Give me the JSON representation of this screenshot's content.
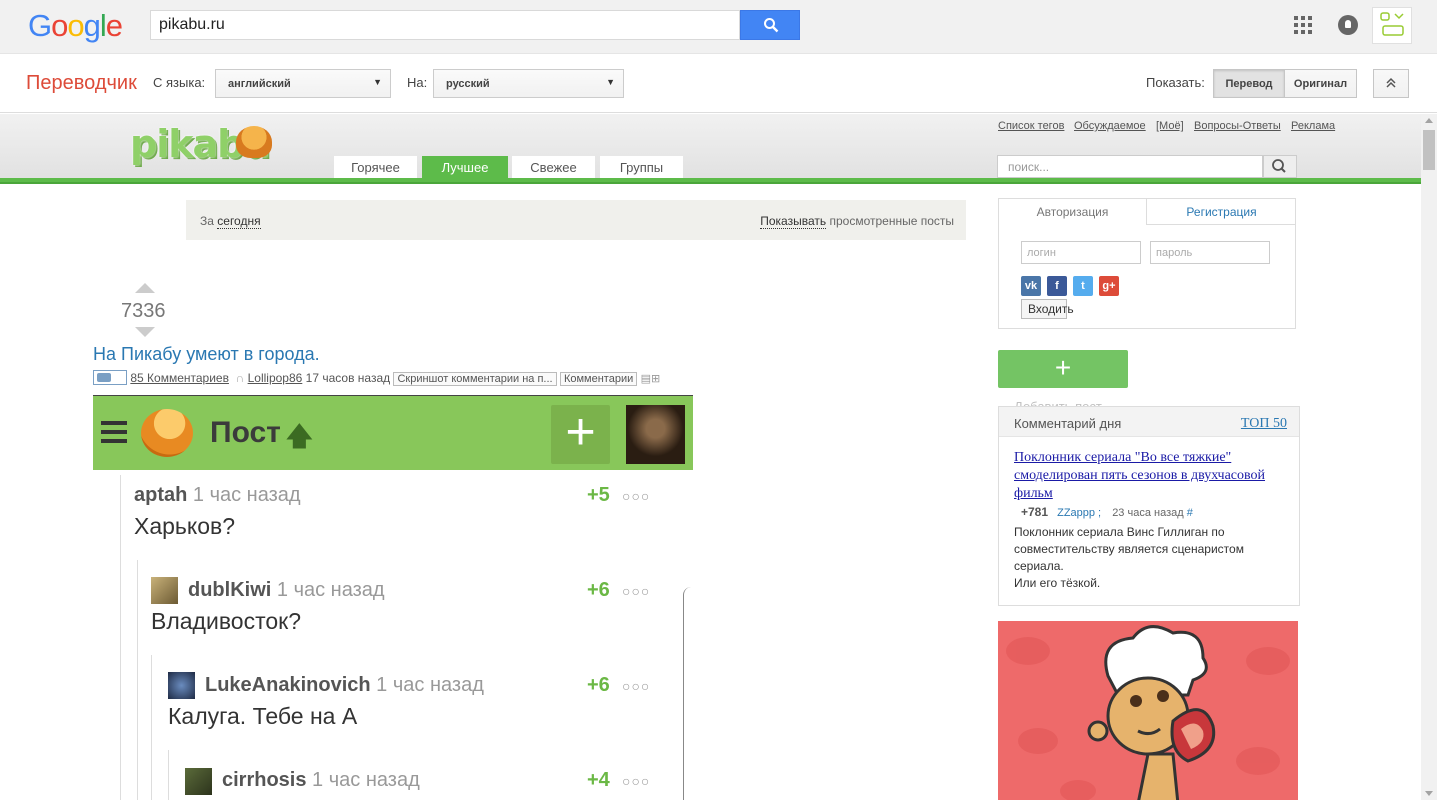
{
  "google": {
    "logo": [
      "G",
      "o",
      "o",
      "g",
      "l",
      "e"
    ],
    "logo_colors": [
      "#4285f4",
      "#ea4335",
      "#fbbc05",
      "#4285f4",
      "#34a853",
      "#ea4335"
    ],
    "search_value": "pikabu.ru"
  },
  "translate": {
    "title": "Переводчик",
    "from_label": "С языка:",
    "from_value": "английский",
    "to_label": "На:",
    "to_value": "русский",
    "show_label": "Показать:",
    "btn_translation": "Перевод",
    "btn_original": "Оригинал"
  },
  "pikabu": {
    "logo": "pikabu",
    "top_menu": [
      "Список тегов",
      "Обсуждаемое",
      "[Моё]",
      "Вопросы-Ответы",
      "Реклама"
    ],
    "tabs": [
      "Горячее",
      "Лучшее",
      "Свежее",
      "Группы"
    ],
    "active_tab": "Лучшее",
    "search_placeholder": "поиск...",
    "accent": "#5dbb4a"
  },
  "filter": {
    "prefix": "За",
    "period": "сегодня",
    "show": "Показывать",
    "show_rest": "просмотренные посты"
  },
  "post": {
    "rating": "7336",
    "title": "На Пикабу умеют в города.",
    "comments": "85 Комментариев",
    "author": "Lollipop86",
    "time": "17 часов назад",
    "tags": [
      "Скриншот комментарии на п...",
      "Комментарии"
    ]
  },
  "screenshot": {
    "header_title": "Пост",
    "comments": [
      {
        "author": "aptah",
        "time": "1 час назад",
        "score": "+5",
        "text": "Харьков?"
      },
      {
        "author": "dublKiwi",
        "time": "1 час назад",
        "score": "+6",
        "text": "Владивосток?"
      },
      {
        "author": "LukeAnakinovich",
        "time": "1 час назад",
        "score": "+6",
        "text": "Калуга. Тебе на А"
      },
      {
        "author": "cirrhosis",
        "time": "1 час назад",
        "score": "+4",
        "text": ""
      }
    ]
  },
  "sidebar": {
    "auth_tab": "Авторизация",
    "reg_tab": "Регистрация",
    "login_placeholder": "логин",
    "password_placeholder": "пароль",
    "social": [
      "vk",
      "fb",
      "tw",
      "g+"
    ],
    "login_button": "Входить",
    "add_post_label": "Добавить пост",
    "cod_title": "Комментарий дня",
    "cod_top": "ТОП 50",
    "cod_link": "Поклонник сериала \"Во все тяжкие\" смоделирован пять сезонов в двухчасовой фильм",
    "cod_score": "+781",
    "cod_author": "ZZappp ;",
    "cod_time": "23 часа назад",
    "cod_hash": "#",
    "cod_text": "Поклонник сериала Винс Гиллиган по совместительству является сценаристом сериала.\nИли его тёзкой."
  }
}
